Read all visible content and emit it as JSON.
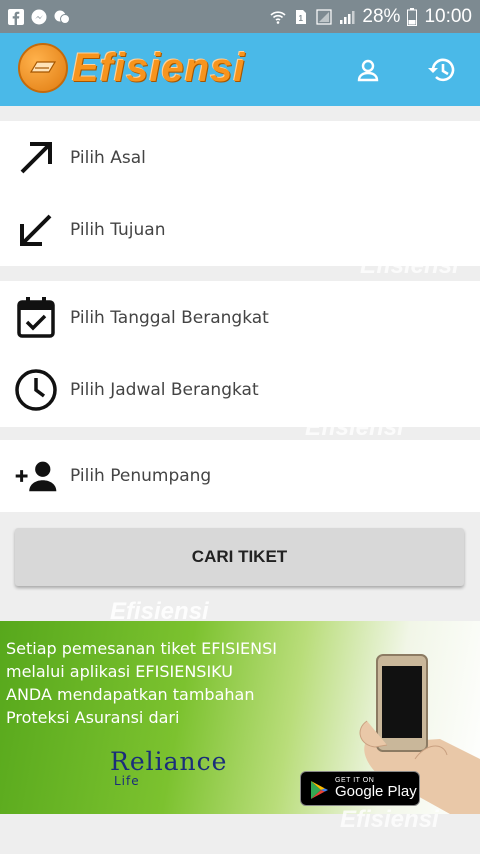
{
  "status_bar": {
    "battery": "28%",
    "time": "10:00",
    "icons": [
      "facebook-icon",
      "messenger-icon",
      "chat-icon",
      "wifi-icon",
      "sim-icon",
      "signal-icon",
      "signal-icon",
      "battery-icon"
    ]
  },
  "app_bar": {
    "title": "Efisiensi",
    "actions": [
      "account-icon",
      "history-icon"
    ]
  },
  "form": {
    "origin_label": "Pilih Asal",
    "destination_label": "Pilih Tujuan",
    "date_label": "Pilih Tanggal Berangkat",
    "schedule_label": "Pilih Jadwal Berangkat",
    "passenger_label": "Pilih Penumpang"
  },
  "watermark_text": "Efisiensi",
  "search_button": "CARI TIKET",
  "banner": {
    "lines": [
      "Setiap pemesanan tiket EFISIENSI",
      "melalui aplikasi EFISIENSIKU",
      "ANDA mendapatkan tambahan",
      "Proteksi Asuransi dari"
    ],
    "partner": "Reliance",
    "partner_sub": "Life",
    "store_small": "GET IT ON",
    "store_big": "Google Play"
  },
  "colors": {
    "app_bar": "#4ab9e8",
    "status_bar": "#7d8a91",
    "logo_orange": "#f7941d",
    "banner_green": "#7cc22f"
  }
}
